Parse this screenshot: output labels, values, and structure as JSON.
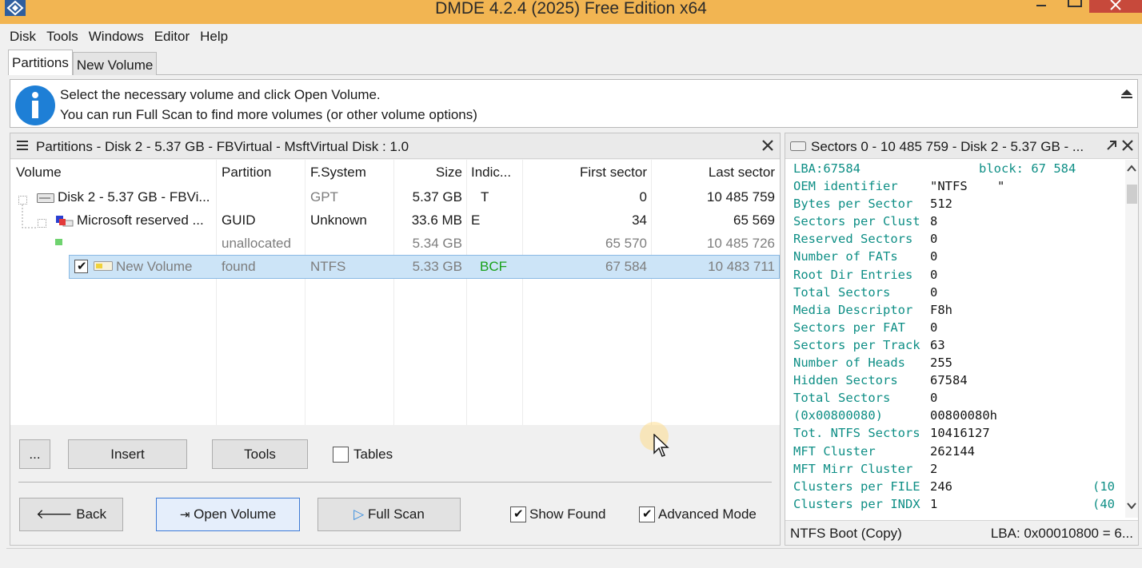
{
  "window": {
    "title": "DMDE 4.2.4 (2025) Free Edition x64"
  },
  "menu": [
    "Disk",
    "Tools",
    "Windows",
    "Editor",
    "Help"
  ],
  "tabs": [
    "Partitions",
    "New Volume"
  ],
  "info": {
    "line1": "Select the necessary volume and click Open Volume.",
    "line2": "You can run Full Scan to find more volumes (or other volume options)"
  },
  "partitions_panel": {
    "title": "Partitions - Disk 2 - 5.37 GB - FBVirtual - MsftVirtual Disk : 1.0",
    "columns": [
      "Volume",
      "Partition",
      "F.System",
      "Size",
      "Indic...",
      "First sector",
      "Last sector"
    ],
    "rows": [
      {
        "volume": "Disk 2 - 5.37 GB - FBVi...",
        "partition": "",
        "fs": "GPT",
        "size": "5.37 GB",
        "ind": "T",
        "first": "0",
        "last": "10 485 759"
      },
      {
        "volume": "Microsoft reserved ...",
        "partition": "GUID",
        "fs": "Unknown",
        "size": "33.6 MB",
        "ind": "E",
        "first": "34",
        "last": "65 569"
      },
      {
        "volume": "",
        "partition": "unallocated",
        "fs": "",
        "size": "5.34 GB",
        "ind": "",
        "first": "65 570",
        "last": "10 485 726"
      },
      {
        "volume": "New Volume",
        "partition": "found",
        "fs": "NTFS",
        "size": "5.33 GB",
        "ind": "BCF",
        "first": "67 584",
        "last": "10 483 711"
      }
    ],
    "buttons": {
      "more": "...",
      "insert": "Insert",
      "tools": "Tools",
      "back": "Back",
      "open_volume": "Open Volume",
      "full_scan": "Full Scan"
    },
    "checks": {
      "tables": "Tables",
      "show_found": "Show Found",
      "advanced_mode": "Advanced Mode"
    }
  },
  "sectors_panel": {
    "title": "Sectors 0 - 10 485 759 - Disk 2 - 5.37 GB - ...",
    "lba_line": {
      "key": "LBA:67584",
      "right": "block: 67 584"
    },
    "rows": [
      {
        "k": "OEM identifier",
        "v": "\"NTFS    \""
      },
      {
        "k": "Bytes per Sector",
        "v": "512"
      },
      {
        "k": "Sectors per Clust",
        "v": "8"
      },
      {
        "k": "Reserved Sectors",
        "v": "0"
      },
      {
        "k": "Number of FATs",
        "v": "0"
      },
      {
        "k": "Root Dir Entries",
        "v": "0"
      },
      {
        "k": "Total Sectors",
        "v": "0"
      },
      {
        "k": "Media Descriptor",
        "v": "F8h"
      },
      {
        "k": "Sectors per FAT",
        "v": "0"
      },
      {
        "k": "Sectors per Track",
        "v": "63"
      },
      {
        "k": "Number of Heads",
        "v": "255"
      },
      {
        "k": "Hidden Sectors",
        "v": "67584"
      },
      {
        "k": "Total Sectors",
        "v": "0"
      },
      {
        "k": "(0x00800080)",
        "v": "00800080h"
      },
      {
        "k": "Tot. NTFS Sectors",
        "v": "10416127"
      },
      {
        "k": "MFT Cluster",
        "v": "262144"
      },
      {
        "k": "MFT Mirr Cluster",
        "v": "2"
      },
      {
        "k": "Clusters per FILE",
        "v": "246",
        "c": "(10"
      },
      {
        "k": "Clusters per INDX",
        "v": "1",
        "c": "(40"
      }
    ],
    "status_left": "NTFS Boot (Copy)",
    "status_right": "LBA: 0x00010800 = 6..."
  }
}
